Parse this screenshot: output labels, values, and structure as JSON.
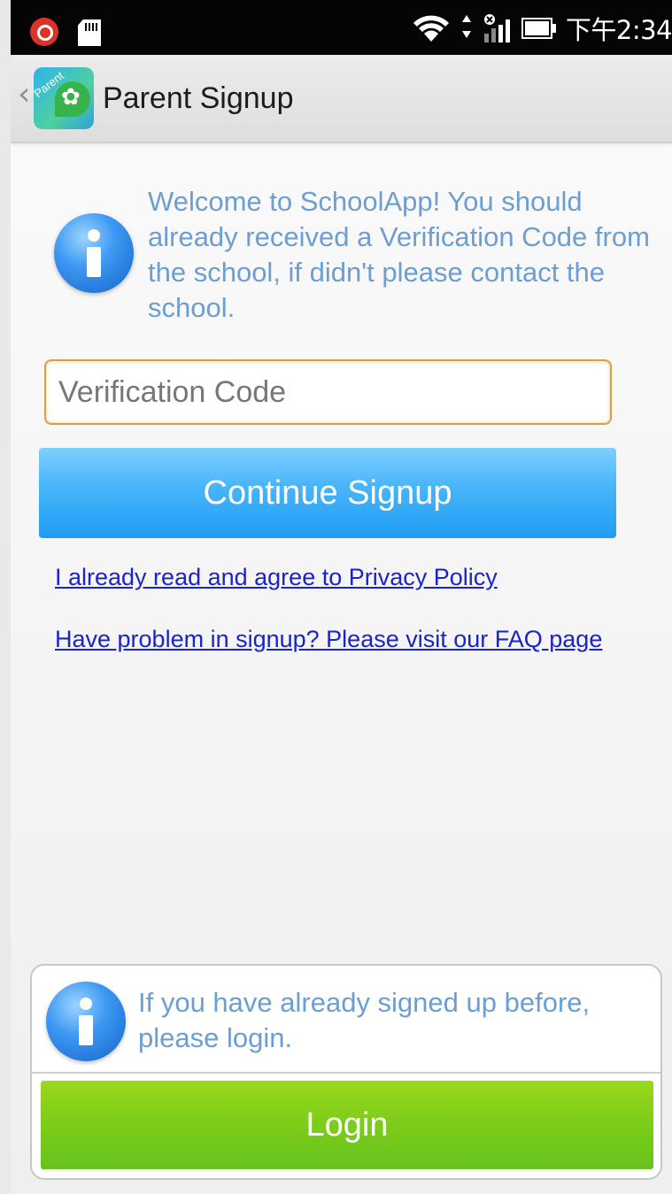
{
  "status_bar": {
    "time": "下午2:34",
    "icons": [
      "app-notification-icon",
      "sd-card-icon",
      "wifi-icon",
      "data-arrows-icon",
      "signal-icon",
      "battery-icon"
    ]
  },
  "action_bar": {
    "back_chevron": "‹",
    "logo_text": "Parent",
    "title": "Parent Signup"
  },
  "welcome": {
    "icon": "info-icon",
    "message": "Welcome to SchoolApp! You should already received a Verification Code from the school, if didn't please contact the school."
  },
  "form": {
    "verification_placeholder": "Verification Code",
    "verification_value": "",
    "continue_label": "Continue Signup"
  },
  "links": {
    "privacy": "I already read and agree to Privacy Policy",
    "faq": "Have problem in signup? Please visit our FAQ page"
  },
  "login_panel": {
    "icon": "info-icon",
    "message": "If you have already signed up before, please login.",
    "login_label": "Login"
  },
  "colors": {
    "accent_blue": "#4bb6fb",
    "login_green": "#7ccc1a",
    "info_text": "#6c9ed2",
    "link": "#1a24c8",
    "input_focus": "#d6a04b"
  }
}
